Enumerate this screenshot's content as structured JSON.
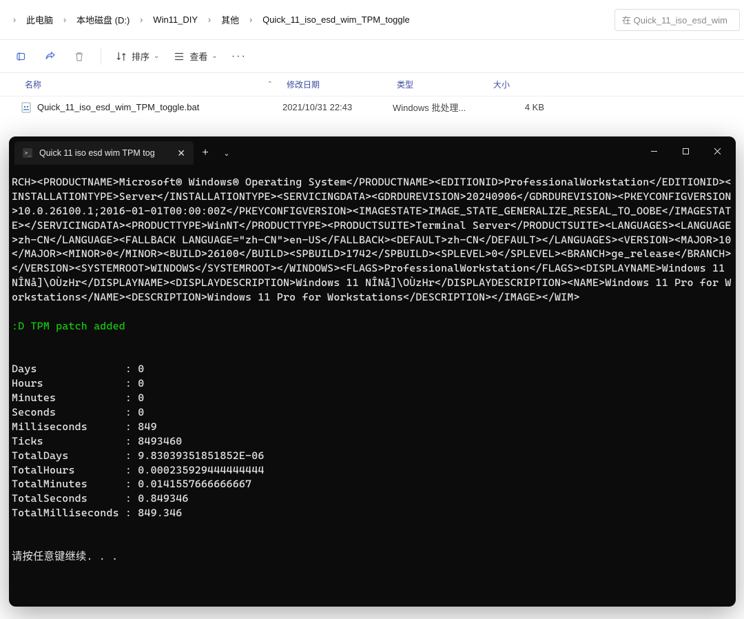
{
  "breadcrumb": {
    "segments": [
      "此电脑",
      "本地磁盘 (D:)",
      "Win11_DIY",
      "其他",
      "Quick_11_iso_esd_wim_TPM_toggle"
    ]
  },
  "search": {
    "placeholder": "在 Quick_11_iso_esd_wim"
  },
  "toolbar": {
    "sort_label": "排序",
    "view_label": "查看"
  },
  "headers": {
    "name": "名称",
    "date": "修改日期",
    "type": "类型",
    "size": "大小"
  },
  "files": [
    {
      "name": "Quick_11_iso_esd_wim_TPM_toggle.bat",
      "date": "2021/10/31 22:43",
      "type": "Windows 批处理...",
      "size": "4 KB"
    }
  ],
  "terminal": {
    "tab_title": "Quick 11 iso esd wim TPM tog",
    "xml_block": "RCH><PRODUCTNAME>Microsoft® Windows® Operating System</PRODUCTNAME><EDITIONID>ProfessionalWorkstation</EDITIONID><INSTALLATIONTYPE>Server</INSTALLATIONTYPE><SERVICINGDATA><GDRDUREVISION>20240906</GDRDUREVISION><PKEYCONFIGVERSION>10.0.26100.1;2016-01-01T00:00:00Z</PKEYCONFIGVERSION><IMAGESTATE>IMAGE_STATE_GENERALIZE_RESEAL_TO_OOBE</IMAGESTATE></SERVICINGDATA><PRODUCTTYPE>WinNT</PRODUCTTYPE><PRODUCTSUITE>Terminal Server</PRODUCTSUITE><LANGUAGES><LANGUAGE>zh-CN</LANGUAGE><FALLBACK LANGUAGE=\"zh-CN\">en-US</FALLBACK><DEFAULT>zh-CN</DEFAULT></LANGUAGES><VERSION><MAJOR>10</MAJOR><MINOR>0</MINOR><BUILD>26100</BUILD><SPBUILD>1742</SPBUILD><SPLEVEL>0</SPLEVEL><BRANCH>ge_release</BRANCH></VERSION><SYSTEMROOT>WINDOWS</SYSTEMROOT></WINDOWS><FLAGS>ProfessionalWorkstation</FLAGS><DISPLAYNAME>Windows 11 NÎNå]\\OÙzHr</DISPLAYNAME><DISPLAYDESCRIPTION>Windows 11 NÎNå]\\OÙzHr</DISPLAYDESCRIPTION><NAME>Windows 11 Pro for Workstations</NAME><DESCRIPTION>Windows 11 Pro for Workstations</DESCRIPTION></IMAGE></WIM>",
    "green_line": ":D TPM patch added",
    "stats": "Days              : 0\nHours             : 0\nMinutes           : 0\nSeconds           : 0\nMilliseconds      : 849\nTicks             : 8493460\nTotalDays         : 9.83039351851852E-06\nTotalHours        : 0.000235929444444444\nTotalMinutes      : 0.0141557666666667\nTotalSeconds      : 0.849346\nTotalMilliseconds : 849.346",
    "press_any_key": "请按任意键继续. . ."
  }
}
